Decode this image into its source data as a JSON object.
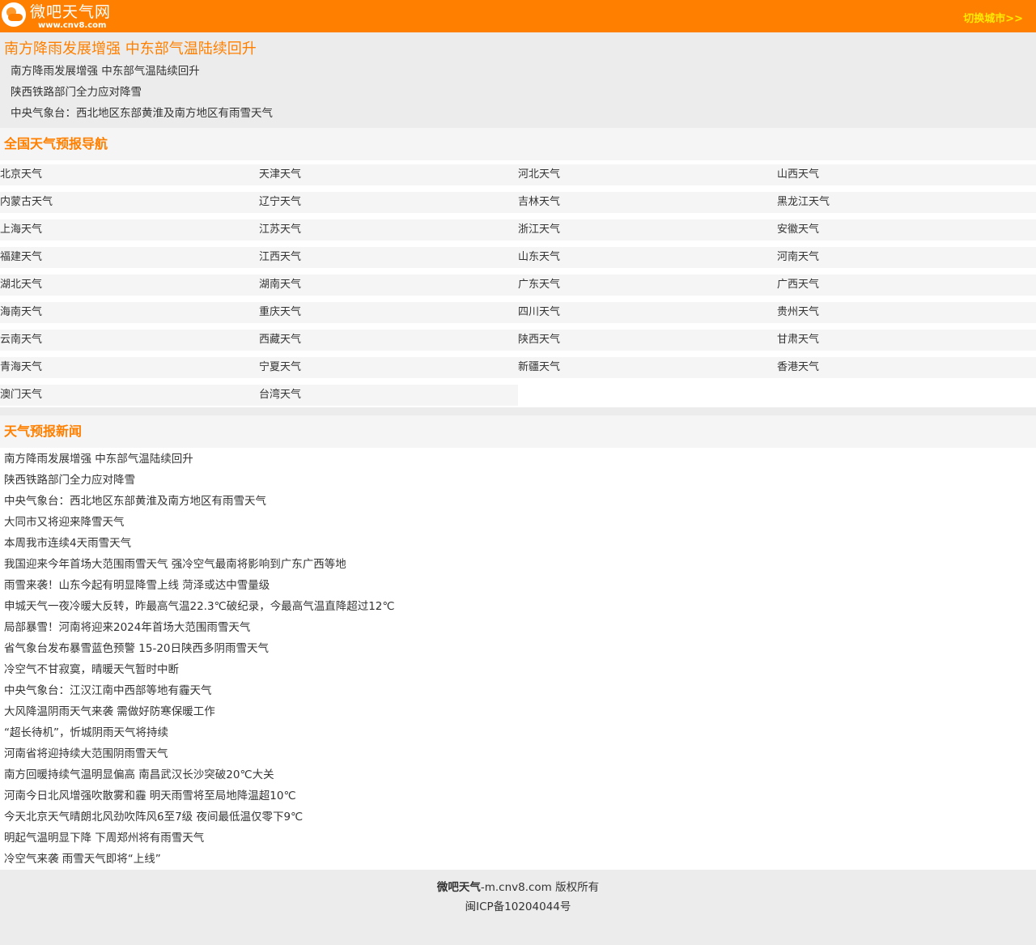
{
  "header": {
    "logo_name": "微吧天气网",
    "logo_url": "www.cnv8.com",
    "switch_city": "切换城市>>"
  },
  "headline": {
    "title": "南方降雨发展增强 中东部气温陆续回升",
    "items": [
      "南方降雨发展增强 中东部气温陆续回升",
      "陕西铁路部门全力应对降雪",
      "中央气象台：西北地区东部黄淮及南方地区有雨雪天气"
    ]
  },
  "nav": {
    "title": "全国天气预报导航",
    "items": [
      "北京天气",
      "天津天气",
      "河北天气",
      "山西天气",
      "内蒙古天气",
      "辽宁天气",
      "吉林天气",
      "黑龙江天气",
      "上海天气",
      "江苏天气",
      "浙江天气",
      "安徽天气",
      "福建天气",
      "江西天气",
      "山东天气",
      "河南天气",
      "湖北天气",
      "湖南天气",
      "广东天气",
      "广西天气",
      "海南天气",
      "重庆天气",
      "四川天气",
      "贵州天气",
      "云南天气",
      "西藏天气",
      "陕西天气",
      "甘肃天气",
      "青海天气",
      "宁夏天气",
      "新疆天气",
      "香港天气",
      "澳门天气",
      "台湾天气"
    ]
  },
  "news": {
    "title": "天气预报新闻",
    "items": [
      "南方降雨发展增强 中东部气温陆续回升",
      "陕西铁路部门全力应对降雪",
      "中央气象台：西北地区东部黄淮及南方地区有雨雪天气",
      "大同市又将迎来降雪天气",
      "本周我市连续4天雨雪天气",
      "我国迎来今年首场大范围雨雪天气 强冷空气最南将影响到广东广西等地",
      "雨雪来袭！山东今起有明显降雪上线 菏泽或达中雪量级",
      "申城天气一夜冷暖大反转，昨最高气温22.3℃破纪录，今最高气温直降超过12℃",
      "局部暴雪！河南将迎来2024年首场大范围雨雪天气",
      "省气象台发布暴雪蓝色预警 15-20日陕西多阴雨雪天气",
      "冷空气不甘寂寞，晴暖天气暂时中断",
      "中央气象台：江汉江南中西部等地有霾天气",
      "大风降温阴雨天气来袭 需做好防寒保暖工作",
      "“超长待机”，忻城阴雨天气将持续",
      "河南省将迎持续大范围阴雨雪天气",
      "南方回暖持续气温明显偏高 南昌武汉长沙突破20℃大关",
      "河南今日北风增强吹散雾和霾 明天雨雪将至局地降温超10℃",
      "今天北京天气晴朗北风劲吹阵风6至7级 夜间最低温仅零下9℃",
      "明起气温明显下降 下周郑州将有雨雪天气",
      "冷空气来袭 雨雪天气即将“上线”"
    ]
  },
  "footer": {
    "brand": "微吧天气",
    "copyright": "-m.cnv8.com 版权所有",
    "icp": "闽ICP备10204044号"
  },
  "colors": {
    "brand": "#ff8000",
    "switch": "#ffea00",
    "bg_gray": "#ececec",
    "cell_bg": "#f5f5f5"
  }
}
